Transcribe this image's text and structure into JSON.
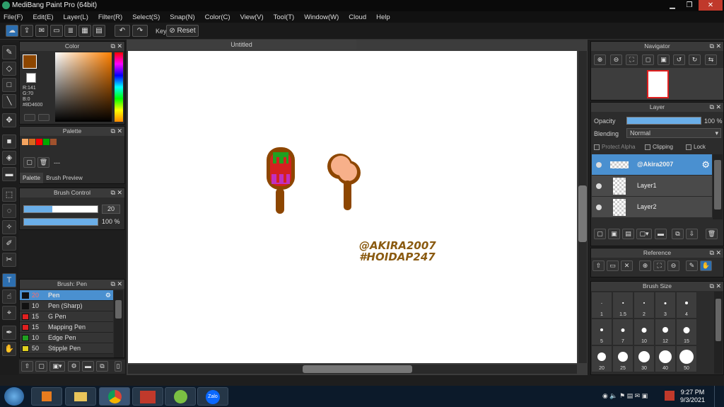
{
  "window": {
    "title": "MediBang Paint Pro (64bit)",
    "minimize": "▁",
    "restore": "❐",
    "close": "✕"
  },
  "menu": [
    "File(F)",
    "Edit(E)",
    "Layer(L)",
    "Filter(R)",
    "Select(S)",
    "Snap(N)",
    "Color(C)",
    "View(V)",
    "Tool(T)",
    "Window(W)",
    "Cloud",
    "Help"
  ],
  "toolbar": {
    "key_label": "Key",
    "reset_label": "Reset"
  },
  "color_panel": {
    "title": "Color",
    "rgb": [
      "R:141",
      "G:70",
      "B:0"
    ],
    "hex": "#8D4600",
    "main_color": "#8D4600"
  },
  "palette_panel": {
    "title": "Palette",
    "colors": [
      "#f4a460",
      "#d2691e",
      "#ff0000",
      "#00aa00",
      "#a0522d"
    ],
    "entry_text": "---",
    "tab_palette": "Palette",
    "tab_preview": "Brush Preview"
  },
  "brush_control": {
    "title": "Brush Control",
    "size_value": "20",
    "opacity_value": "100 %",
    "size_fraction": 0.38,
    "opacity_fraction": 1.0
  },
  "brush_list": {
    "title": "Brush: Pen",
    "items": [
      {
        "size": "20",
        "name": "Pen",
        "color": "#111111"
      },
      {
        "size": "10",
        "name": "Pen (Sharp)",
        "color": "#111111"
      },
      {
        "size": "15",
        "name": "G Pen",
        "color": "#e02020"
      },
      {
        "size": "15",
        "name": "Mapping Pen",
        "color": "#e02020"
      },
      {
        "size": "10",
        "name": "Edge Pen",
        "color": "#20a020"
      },
      {
        "size": "50",
        "name": "Stipple Pen",
        "color": "#e0d020"
      }
    ]
  },
  "document": {
    "tab_title": "Untitled",
    "watermark_line1": "@AKIRA2007",
    "watermark_line2": "#HOIDAP247"
  },
  "navigator": {
    "title": "Navigator"
  },
  "layer_panel": {
    "title": "Layer",
    "opacity_label": "Opacity",
    "opacity_value": "100 %",
    "blending_label": "Blending",
    "blending_value": "Normal",
    "protect_alpha": "Protect Alpha",
    "clipping": "Clipping",
    "lock": "Lock",
    "layers": [
      {
        "name": "@Akira2007",
        "selected": true
      },
      {
        "name": "Layer1",
        "selected": false
      },
      {
        "name": "Layer2",
        "selected": false
      }
    ]
  },
  "reference_panel": {
    "title": "Reference"
  },
  "brush_size_panel": {
    "title": "Brush Size",
    "sizes": [
      "1",
      "1.5",
      "2",
      "3",
      "4",
      "5",
      "7",
      "10",
      "12",
      "15",
      "20",
      "25",
      "30",
      "40",
      "50"
    ]
  },
  "taskbar": {
    "time": "9:27 PM",
    "date": "9/3/2021",
    "zalo_label": "Zalo"
  }
}
